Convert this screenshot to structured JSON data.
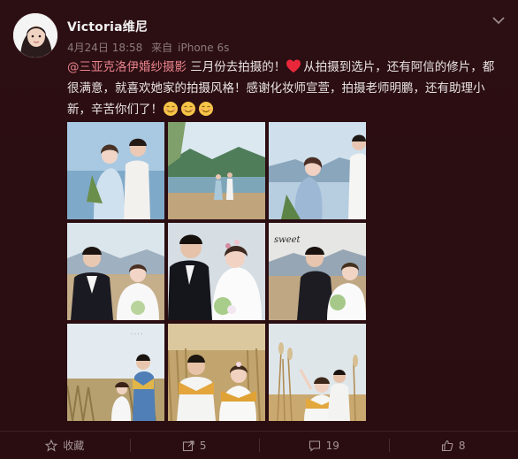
{
  "post": {
    "username": "Victoria维尼",
    "date": "4月24日 18:58",
    "source_prefix": "来自",
    "source": "iPhone 6s",
    "mention": "@三亚克洛伊婚纱摄影",
    "text_line1": " 三月份去拍摄的！",
    "text_after_heart": "从拍摄到选片，还有阿信的修片，都",
    "text_line2": "很满意，就喜欢她家的拍摄风格！感谢化妆师宣萱，拍摄老师明鹏，还有助理小",
    "text_line3": "新，辛苦你们了！"
  },
  "actions": {
    "favorite_label": "收藏",
    "repost_count": "5",
    "comment_count": "19",
    "like_count": "8"
  },
  "icons": [
    "chevron-down-icon",
    "heart-emoji",
    "smile-emoji",
    "star-icon",
    "repost-icon",
    "comment-icon",
    "thumbs-up-icon"
  ],
  "colors": {
    "background": "#2b0e12",
    "mention": "#e9838c",
    "muted": "#8c7a7c"
  }
}
